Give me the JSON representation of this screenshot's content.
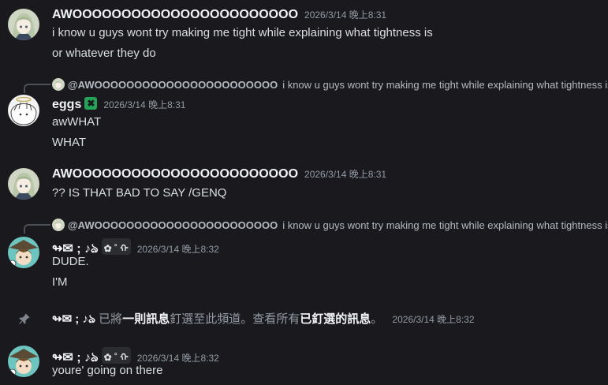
{
  "messages": [
    {
      "author": "AWOOOOOOOOOOOOOOOOOOOOOOO",
      "timestamp": "2026/3/14 晚上8:31",
      "lines": [
        "i know u guys wont try making me tight while explaining what tightness is",
        "or whatever they do"
      ],
      "avatar": "anime-girl-avatar"
    },
    {
      "reply_to": {
        "author": "@AWOOOOOOOOOOOOOOOOOOOOOOO",
        "text": "i know u guys wont try making me tight while explaining what tightness is"
      },
      "author": "eggs",
      "badge": "✖",
      "timestamp": "2026/3/14 晚上8:31",
      "lines": [
        "awWHAT",
        "WHAT"
      ],
      "avatar": "angel-sketch-avatar"
    },
    {
      "author": "AWOOOOOOOOOOOOOOOOOOOOOOO",
      "timestamp": "2026/3/14 晚上8:31",
      "lines": [
        "?? IS THAT BAD TO SAY /GENQ"
      ],
      "avatar": "anime-girl-avatar"
    },
    {
      "reply_to": {
        "author": "@AWOOOOOOOOOOOOOOOOOOOOOOO",
        "text": "i know u guys wont try making me tight while explaining what tightness is"
      },
      "author": "↬✉︎ ; ♪ঌ",
      "badge": "✿ ˚ ᡣ",
      "timestamp": "2026/3/14 晚上8:32",
      "lines": [
        "DUDE.",
        "I'M"
      ],
      "avatar": "boy-hat-avatar"
    },
    {
      "system": true,
      "author": "↬✉︎ ; ♪ঌ",
      "text_1": "已將",
      "bold_1": "一則訊息",
      "text_2": "釘選至此頻道。查看所有",
      "bold_2": "已釘選的訊息",
      "text_3": "。",
      "timestamp": "2026/3/14 晚上8:32"
    },
    {
      "author": "↬✉︎ ; ♪ঌ",
      "badge": "✿ ˚ ᡣ",
      "timestamp": "2026/3/14 晚上8:32",
      "lines": [
        "youre' going on there"
      ],
      "avatar": "boy-hat-avatar"
    }
  ],
  "colors": {
    "background": "#1a1a1e",
    "text": "#dbdee1",
    "muted": "#949ba4",
    "badge_green": "#23a559"
  }
}
